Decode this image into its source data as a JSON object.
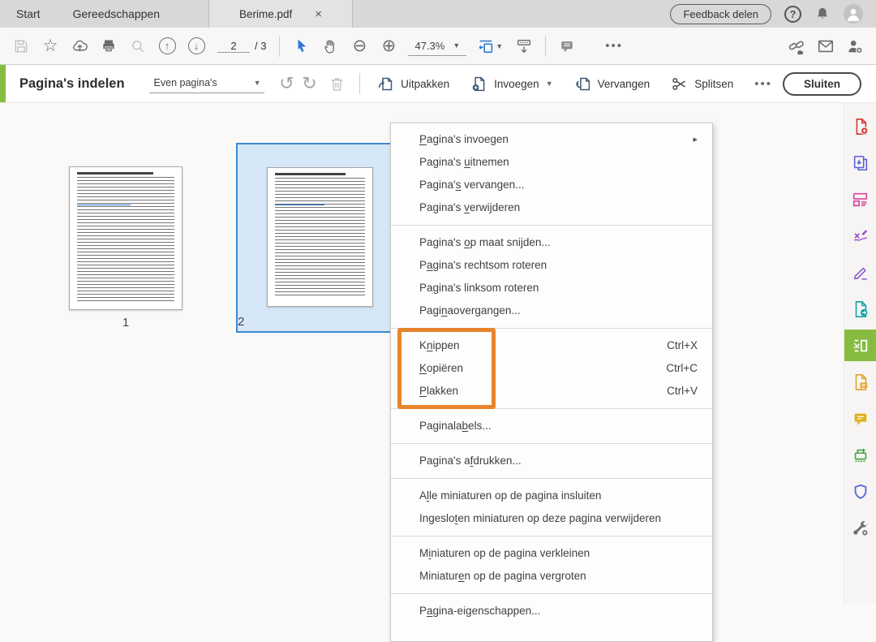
{
  "colors": {
    "accent_green": "#86BC40",
    "selection_blue": "#3E87D6",
    "highlight_orange": "#E8842B"
  },
  "titlebar": {
    "tabs": [
      {
        "label": "Start"
      },
      {
        "label": "Gereedschappen"
      }
    ],
    "document_tab": {
      "label": "Berime.pdf",
      "close_glyph": "×"
    },
    "feedback_button_label": "Feedback delen"
  },
  "toolbar": {
    "page_current": "2",
    "page_total_label": "/ 3",
    "zoom_level": "47.3%",
    "more_label": "•••"
  },
  "tool_header": {
    "title": "Pagina's indelen",
    "range_dropdown_value": "Even pagina's",
    "extract_label": "Uitpakken",
    "insert_label": "Invoegen",
    "replace_label": "Vervangen",
    "split_label": "Splitsen",
    "more_label": "•••",
    "close_label": "Sluiten"
  },
  "thumbnails": [
    {
      "page_label": "1",
      "selected": false
    },
    {
      "page_label": "2",
      "selected": true
    }
  ],
  "context_menu": {
    "highlight_color": "#E8842B",
    "groups": [
      {
        "items": [
          {
            "name": "menu-item-paginas-invoegen",
            "label": "Pagina's invoegen",
            "u": 0,
            "submenu": true
          },
          {
            "name": "menu-item-paginas-uitnemen",
            "label": "Pagina's uitnemen",
            "u": 9
          },
          {
            "name": "menu-item-paginas-vervangen",
            "label": "Pagina's vervangen...",
            "u": 7
          },
          {
            "name": "menu-item-paginas-verwijderen",
            "label": "Pagina's verwijderen",
            "u": 9
          }
        ]
      },
      {
        "items": [
          {
            "name": "menu-item-paginas-op-maat-snijden",
            "label": "Pagina's op maat snijden...",
            "u": 9
          },
          {
            "name": "menu-item-paginas-rechtsom-roteren",
            "label": "Pagina's rechtsom roteren",
            "u": 1
          },
          {
            "name": "menu-item-paginas-linksom-roteren",
            "label": "Pagina's linksom roteren",
            "u": 2
          },
          {
            "name": "menu-item-paginaovergangen",
            "label": "Paginaovergangen...",
            "u": 4
          }
        ]
      },
      {
        "highlight": true,
        "items": [
          {
            "name": "menu-item-knippen",
            "label": "Knippen",
            "u": 1,
            "shortcut": "Ctrl+X"
          },
          {
            "name": "menu-item-kopieren",
            "label": "Kopiëren",
            "u": 0,
            "shortcut": "Ctrl+C"
          },
          {
            "name": "menu-item-plakken",
            "label": "Plakken",
            "u": 0,
            "shortcut": "Ctrl+V"
          }
        ]
      },
      {
        "items": [
          {
            "name": "menu-item-paginalabels",
            "label": "Paginalabels...",
            "u": 8
          }
        ]
      },
      {
        "items": [
          {
            "name": "menu-item-paginas-afdrukken",
            "label": "Pagina's afdrukken...",
            "u": 10
          }
        ]
      },
      {
        "items": [
          {
            "name": "menu-item-alle-miniaturen-insluiten",
            "label": "Alle miniaturen op de pagina insluiten",
            "u": 1
          },
          {
            "name": "menu-item-ingesloten-miniaturen-verwijderen",
            "label": "Ingesloten miniaturen op deze pagina verwijderen",
            "u": 7
          }
        ]
      },
      {
        "items": [
          {
            "name": "menu-item-miniaturen-verkleinen",
            "label": "Miniaturen op de pagina verkleinen",
            "u": 1
          },
          {
            "name": "menu-item-miniaturen-vergroten",
            "label": "Miniaturen op de pagina vergroten",
            "u": 8
          }
        ]
      },
      {
        "items": [
          {
            "name": "menu-item-pagina-eigenschappen",
            "label": "Pagina-eigenschappen...",
            "u": 1
          }
        ]
      }
    ]
  },
  "right_sidebar": {
    "icons": [
      {
        "name": "create-pdf-icon",
        "color": "#D3342B"
      },
      {
        "name": "combine-files-icon",
        "color": "#5A5ED8"
      },
      {
        "name": "edit-pdf-icon",
        "color": "#D8409C"
      },
      {
        "name": "fill-sign-icon",
        "color": "#9C50D0"
      },
      {
        "name": "sign-pen-icon",
        "color": "#8B53D2"
      },
      {
        "name": "export-pdf-icon",
        "color": "#0FA3A3"
      },
      {
        "name": "organize-pages-icon",
        "color": "#FFFFFF",
        "active": true
      },
      {
        "name": "document-comment-icon",
        "color": "#E2A12F"
      },
      {
        "name": "comment-bubble-icon",
        "color": "#E0AF1D"
      },
      {
        "name": "scan-ocr-icon",
        "color": "#3BA33B"
      },
      {
        "name": "protect-icon",
        "color": "#5A62D8"
      },
      {
        "name": "more-tools-icon",
        "color": "#6E6E6E"
      }
    ]
  }
}
